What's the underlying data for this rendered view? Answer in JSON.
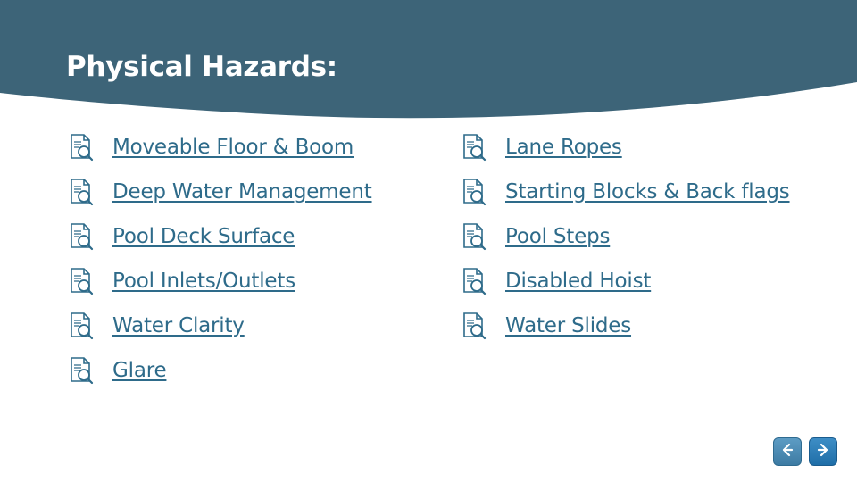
{
  "slide": {
    "title": "Physical Hazards:",
    "title_color": "#ffffff",
    "band_color": "#3d6478",
    "link_color": "#2E6B8A",
    "background": "#ffffff"
  },
  "columns": {
    "left": [
      {
        "icon": "document-search-icon",
        "label": "Moveable Floor & Boom"
      },
      {
        "icon": "document-search-icon",
        "label": "Deep Water Management"
      },
      {
        "icon": "document-search-icon",
        "label": "Pool Deck Surface"
      },
      {
        "icon": "document-search-icon",
        "label": "Pool Inlets/Outlets"
      },
      {
        "icon": "document-search-icon",
        "label": "Water Clarity"
      },
      {
        "icon": "document-search-icon",
        "label": "Glare"
      }
    ],
    "right": [
      {
        "icon": "document-search-icon",
        "label": "Lane Ropes"
      },
      {
        "icon": "document-search-icon",
        "label": "Starting Blocks & Back flags"
      },
      {
        "icon": "document-search-icon",
        "label": "Pool Steps"
      },
      {
        "icon": "document-search-icon",
        "label": "Disabled Hoist"
      },
      {
        "icon": "document-search-icon",
        "label": "Water Slides"
      }
    ]
  },
  "navigation": {
    "prev": {
      "icon": "arrow-left-icon",
      "label": "Previous"
    },
    "next": {
      "icon": "arrow-right-icon",
      "label": "Next"
    }
  }
}
